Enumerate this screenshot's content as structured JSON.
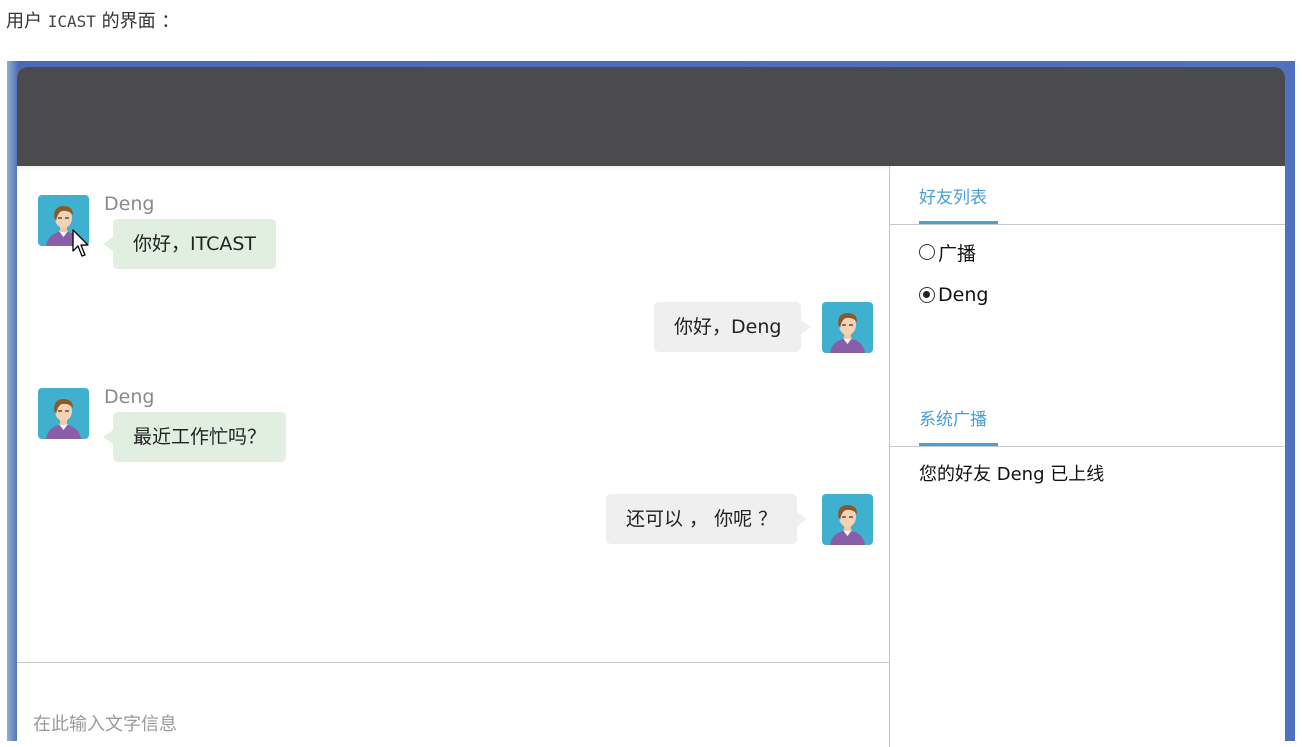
{
  "caption": {
    "prefix": "用户 ",
    "username": "ICAST",
    "suffix": " 的界面 ："
  },
  "chat": {
    "messages": [
      {
        "side": "left",
        "sender": "Deng",
        "text": "你好，ITCAST"
      },
      {
        "side": "right",
        "sender": "",
        "text": "你好，Deng"
      },
      {
        "side": "left",
        "sender": "Deng",
        "text": "最近工作忙吗？"
      },
      {
        "side": "right",
        "sender": "",
        "text": "还可以 ， 你呢 ？"
      }
    ],
    "input_placeholder": "在此输入文字信息"
  },
  "sidebar": {
    "friends_title": "好友列表",
    "friends": [
      {
        "label": "广播",
        "checked": false
      },
      {
        "label": "Deng",
        "checked": true
      }
    ],
    "broadcast_title": "系统广播",
    "broadcast_message": "您的好友 Deng 已上线"
  },
  "colors": {
    "topbar": "#4a4a4f",
    "accent": "#4a9fd4",
    "bubble_left": "#e1efe0",
    "bubble_right": "#efefef",
    "avatar_bg": "#3fb0cf",
    "frame": "#5070c0"
  },
  "icons": {
    "avatar": "person-avatar-icon",
    "cursor": "mouse-pointer-icon"
  }
}
